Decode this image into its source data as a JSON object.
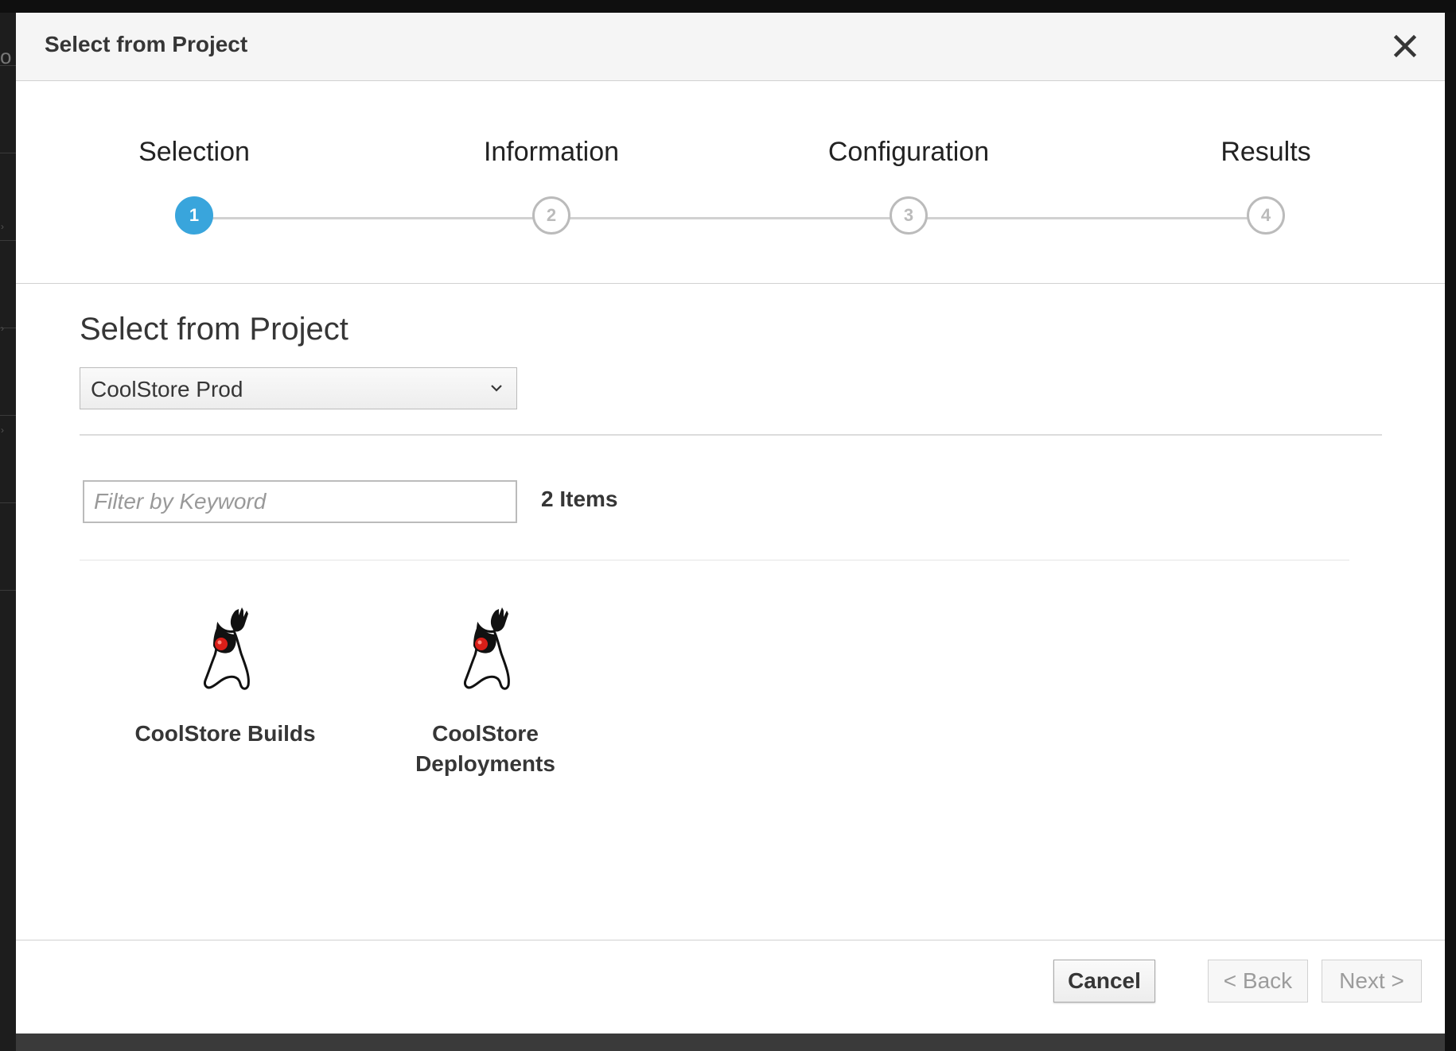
{
  "modal": {
    "title": "Select from Project",
    "close_icon": "close-icon"
  },
  "wizard": {
    "steps": [
      {
        "label": "Selection",
        "number": "1",
        "active": true
      },
      {
        "label": "Information",
        "number": "2",
        "active": false
      },
      {
        "label": "Configuration",
        "number": "3",
        "active": false
      },
      {
        "label": "Results",
        "number": "4",
        "active": false
      }
    ],
    "active_color": "#39a5dc",
    "inactive_color": "#bbbbbb"
  },
  "content": {
    "title": "Select from Project",
    "project_select": {
      "selected": "CoolStore Prod",
      "icon": "chevron-down-icon"
    },
    "filter": {
      "placeholder": "Filter by Keyword",
      "value": ""
    },
    "item_count": "2 Items",
    "items": [
      {
        "label": "CoolStore Builds",
        "icon": "java-duke-icon"
      },
      {
        "label": "CoolStore Deployments",
        "icon": "java-duke-icon"
      }
    ]
  },
  "footer": {
    "cancel_label": "Cancel",
    "back_label": "< Back",
    "next_label": "Next >"
  }
}
